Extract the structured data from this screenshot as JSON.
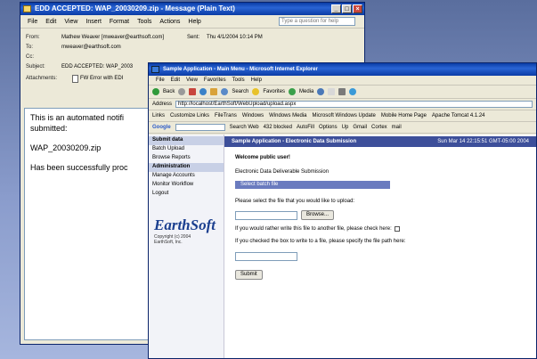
{
  "email": {
    "title": "EDD ACCEPTED: WAP_20030209.zip - Message (Plain Text)",
    "menus": [
      "File",
      "Edit",
      "View",
      "Insert",
      "Format",
      "Tools",
      "Actions",
      "Help"
    ],
    "help_placeholder": "Type a question for help",
    "from_label": "From:",
    "from_value": "Mathew Weaver [mweaver@earthsoft.com]",
    "sent_label": "Sent:",
    "sent_value": "Thu 4/1/2004 10:14 PM",
    "to_label": "To:",
    "to_value": "mweaver@earthsoft.com",
    "cc_label": "Cc:",
    "subject_label": "Subject:",
    "subject_value": "EDD ACCEPTED: WAP_2003",
    "attachments_label": "Attachments:",
    "attachment_name": "FW Error with EDI",
    "body_line1": "This is an automated notifi",
    "body_line2": "submitted:",
    "body_line3": "WAP_20030209.zip",
    "body_line4": "Has been successfully proc"
  },
  "browser": {
    "title": "Sample Application - Main Menu - Microsoft Internet Explorer",
    "menus": [
      "File",
      "Edit",
      "View",
      "Favorites",
      "Tools",
      "Help"
    ],
    "back_label": "Back",
    "search_label": "Search",
    "favorites_label": "Favorites",
    "media_label": "Media",
    "address_label": "Address",
    "address_value": "http://localhost/EarthSoft/WebUpload/upload.aspx",
    "links_label": "Links",
    "links": [
      "Customize Links",
      "FileTrans",
      "Windows",
      "Windows Media",
      "Microsoft Windows Update",
      "Mobile Home Page",
      "Apache Tomcat 4.1.24"
    ],
    "google_label": "Google",
    "google_search_label": "Search Web",
    "google_blocked_label": "432 blocked",
    "google_options": [
      "AutoFill",
      "Options",
      "Up",
      "Gmail",
      "Cortex",
      "mail"
    ],
    "side_admin_hdr": "Submit data",
    "side_items": [
      "Batch Upload",
      "Browse Reports"
    ],
    "side_admin2_hdr": "Administration",
    "side_admin_items": [
      "Manage Accounts",
      "Monitor Workflow",
      "Logout"
    ],
    "logo": "EarthSoft",
    "copyright_line1": "Copyright (c) 2004",
    "copyright_line2": "EarthSoft, Inc.",
    "header_bar_left": "Sample Application - Electronic Data Submission",
    "header_bar_right": "Sun Mar 14 22:15:51 GMT-05:00 2004",
    "welcome": "Welcome public user!",
    "subtitle": "Electronic Data Deliverable Submission",
    "section_bar": "Select batch file",
    "prompt_file": "Please select the file that you would like to upload:",
    "browse_button": "Browse...",
    "prompt_write": "If you would rather write this file to another file, please check here:",
    "prompt_path": "If you checked the box to write to a file, please specify the file path here:",
    "submit_button": "Submit"
  },
  "colors": {
    "titlebar": "#0a3ca6",
    "header_bar": "#3d4f9a",
    "section_bar": "#6a7bbf",
    "logo_blue": "#1b3f8f"
  }
}
